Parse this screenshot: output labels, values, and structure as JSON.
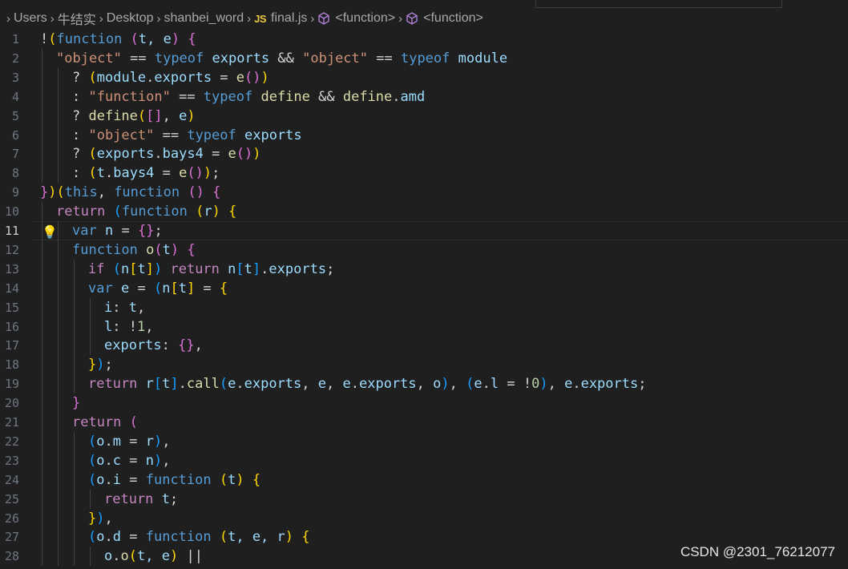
{
  "breadcrumb": {
    "items": [
      "Users",
      "牛结实",
      "Desktop",
      "shanbei_word",
      "final.js",
      "<function>",
      "<function>"
    ],
    "file_icon": "JS",
    "symbol_icon": "function-cube-icon"
  },
  "editor": {
    "current_line": 11,
    "lines": [
      {
        "n": "1"
      },
      {
        "n": "2"
      },
      {
        "n": "3"
      },
      {
        "n": "4"
      },
      {
        "n": "5"
      },
      {
        "n": "6"
      },
      {
        "n": "7"
      },
      {
        "n": "8"
      },
      {
        "n": "9"
      },
      {
        "n": "10"
      },
      {
        "n": "11"
      },
      {
        "n": "12"
      },
      {
        "n": "13"
      },
      {
        "n": "14"
      },
      {
        "n": "15"
      },
      {
        "n": "16"
      },
      {
        "n": "17"
      },
      {
        "n": "18"
      },
      {
        "n": "19"
      },
      {
        "n": "20"
      },
      {
        "n": "21"
      },
      {
        "n": "22"
      },
      {
        "n": "23"
      },
      {
        "n": "24"
      },
      {
        "n": "25"
      },
      {
        "n": "26"
      },
      {
        "n": "27"
      },
      {
        "n": "28"
      }
    ],
    "tokens": {
      "l1": [
        "!",
        "(",
        "function",
        " ",
        "(",
        "t, e",
        ")",
        " ",
        "{"
      ],
      "l2": [
        "\"object\"",
        " == ",
        "typeof",
        " ",
        "exports",
        " && ",
        "\"object\"",
        " == ",
        "typeof",
        " ",
        "module"
      ],
      "l3": [
        "? ",
        "(",
        "module",
        ".",
        "exports",
        " = ",
        "e",
        "(",
        ")",
        ")"
      ],
      "l4": [
        ": ",
        "\"function\"",
        " == ",
        "typeof",
        " ",
        "define",
        " && ",
        "define",
        ".",
        "amd"
      ],
      "l5": [
        "? ",
        "define",
        "(",
        "[",
        "]",
        ", ",
        "e",
        ")"
      ],
      "l6": [
        ": ",
        "\"object\"",
        " == ",
        "typeof",
        " ",
        "exports"
      ],
      "l7": [
        "? ",
        "(",
        "exports",
        ".",
        "bays4",
        " = ",
        "e",
        "(",
        ")",
        ")"
      ],
      "l8": [
        ": ",
        "(",
        "t",
        ".",
        "bays4",
        " = ",
        "e",
        "(",
        ")",
        ")",
        ";"
      ],
      "l9": [
        "}",
        ")",
        "(",
        "this",
        ", ",
        "function",
        " ",
        "(",
        ")",
        " ",
        "{"
      ],
      "l10": [
        "return",
        " ",
        "(",
        "function",
        " ",
        "(",
        "r",
        ")",
        " ",
        "{"
      ],
      "l11": [
        "var",
        " ",
        "n",
        " = ",
        "{",
        "}",
        ";"
      ],
      "l12": [
        "function",
        " ",
        "o",
        "(",
        "t",
        ")",
        " ",
        "{"
      ],
      "l13": [
        "if",
        " ",
        "(",
        "n",
        "[",
        "t",
        "]",
        ")",
        " ",
        "return",
        " ",
        "n",
        "[",
        "t",
        "]",
        ".",
        "exports",
        ";"
      ],
      "l14": [
        "var",
        " ",
        "e",
        " = ",
        "(",
        "n",
        "[",
        "t",
        "]",
        " = ",
        "{"
      ],
      "l15": [
        "i",
        ": ",
        "t",
        ","
      ],
      "l16": [
        "l",
        ": ",
        "!",
        "1",
        ","
      ],
      "l17": [
        "exports",
        ": ",
        "{",
        "}",
        ","
      ],
      "l18": [
        "}",
        ")",
        ";"
      ],
      "l19": [
        "return",
        " ",
        "r",
        "[",
        "t",
        "]",
        ".",
        "call",
        "(",
        "e",
        ".",
        "exports",
        ", ",
        "e",
        ", ",
        "e",
        ".",
        "exports",
        ", ",
        "o",
        ")",
        ", ",
        "(",
        "e",
        ".",
        "l",
        " = ",
        "!",
        "0",
        ")",
        ", ",
        "e",
        ".",
        "exports",
        ";"
      ],
      "l20": [
        "}"
      ],
      "l21": [
        "return",
        " ",
        "("
      ],
      "l22": [
        "(",
        "o",
        ".",
        "m",
        " = ",
        "r",
        ")",
        ","
      ],
      "l23": [
        "(",
        "o",
        ".",
        "c",
        " = ",
        "n",
        ")",
        ","
      ],
      "l24": [
        "(",
        "o",
        ".",
        "i",
        " = ",
        "function",
        " ",
        "(",
        "t",
        ")",
        " ",
        "{"
      ],
      "l25": [
        "return",
        " ",
        "t",
        ";"
      ],
      "l26": [
        "}",
        ")",
        ","
      ],
      "l27": [
        "(",
        "o",
        ".",
        "d",
        " = ",
        "function",
        " ",
        "(",
        "t, e, r",
        ")",
        " ",
        "{"
      ],
      "l28": [
        "o",
        ".",
        "o",
        "(",
        "t, e",
        ")",
        " ",
        "||"
      ]
    }
  },
  "watermark": "CSDN @2301_76212077",
  "colors": {
    "background": "#1f1f1f",
    "keyword": "#569cd6",
    "control": "#c586c0",
    "string": "#ce9178",
    "function": "#dcdcaa",
    "variable": "#9cdcfe",
    "number": "#b5cea8"
  }
}
